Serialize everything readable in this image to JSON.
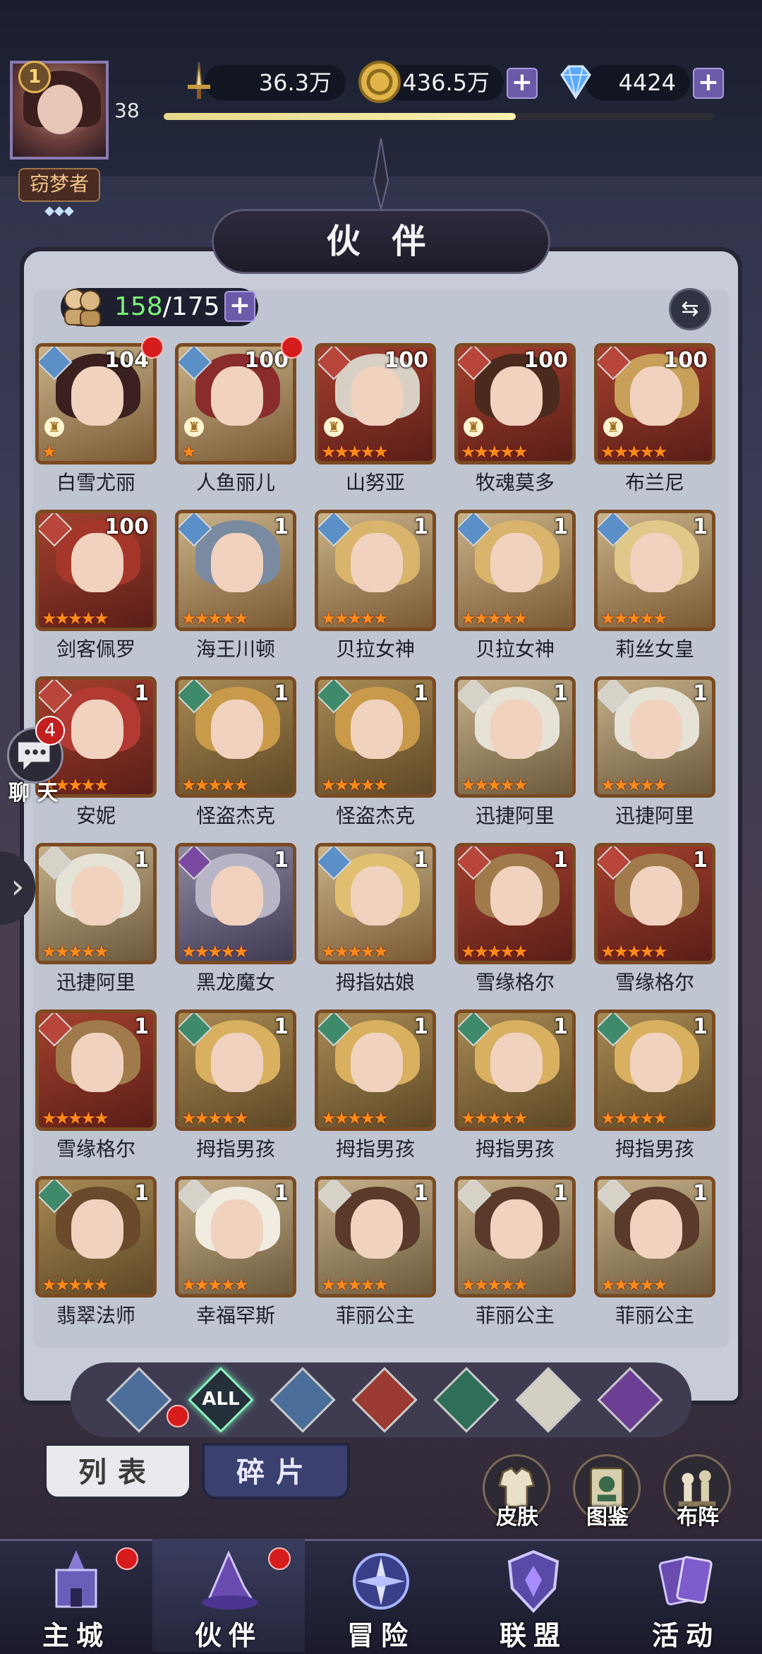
{
  "player": {
    "vip_level": "1",
    "level": "38",
    "title": "窃梦者",
    "title_diamonds": "◆◆◆",
    "xp_fraction": 0.64
  },
  "resources": {
    "power": "36.3万",
    "gold": "436.5万",
    "gems": "4424",
    "plus": "+"
  },
  "panel": {
    "title": "伙 伴",
    "owned": "158",
    "capacity": "/175",
    "swap_icon": "⇆"
  },
  "colors": {
    "water": "#5b8fc7",
    "fire": "#b8463a",
    "wind": "#3e8a6a",
    "light": "#d6d2c7",
    "dark": "#7a4aa0",
    "star": "#ff8c1a",
    "frame": "#7a4a22"
  },
  "heroes": [
    {
      "name": "白雪尤丽",
      "level": "104",
      "element": "water",
      "stars": "★",
      "has_pawn": true,
      "red_dot": true
    },
    {
      "name": "人鱼丽儿",
      "level": "100",
      "element": "water",
      "stars": "★",
      "has_pawn": true,
      "red_dot": true
    },
    {
      "name": "山努亚",
      "level": "100",
      "element": "fire",
      "stars": "★★★★★",
      "has_pawn": true,
      "red_dot": false
    },
    {
      "name": "牧魂莫多",
      "level": "100",
      "element": "fire",
      "stars": "★★★★★",
      "has_pawn": true,
      "red_dot": false
    },
    {
      "name": "布兰尼",
      "level": "100",
      "element": "fire",
      "stars": "★★★★★",
      "has_pawn": true,
      "red_dot": false
    },
    {
      "name": "剑客佩罗",
      "level": "100",
      "element": "fire",
      "stars": "★★★★★",
      "has_pawn": false,
      "red_dot": false
    },
    {
      "name": "海王川顿",
      "level": "1",
      "element": "water",
      "stars": "★★★★★",
      "has_pawn": false,
      "red_dot": false
    },
    {
      "name": "贝拉女神",
      "level": "1",
      "element": "water",
      "stars": "★★★★★",
      "has_pawn": false,
      "red_dot": false
    },
    {
      "name": "贝拉女神",
      "level": "1",
      "element": "water",
      "stars": "★★★★★",
      "has_pawn": false,
      "red_dot": false
    },
    {
      "name": "莉丝女皇",
      "level": "1",
      "element": "water",
      "stars": "★★★★★",
      "has_pawn": false,
      "red_dot": false
    },
    {
      "name": "安妮",
      "level": "1",
      "element": "fire",
      "stars": "★★★★★",
      "has_pawn": false,
      "red_dot": false
    },
    {
      "name": "怪盗杰克",
      "level": "1",
      "element": "wind",
      "stars": "★★★★★",
      "has_pawn": false,
      "red_dot": false
    },
    {
      "name": "怪盗杰克",
      "level": "1",
      "element": "wind",
      "stars": "★★★★★",
      "has_pawn": false,
      "red_dot": false
    },
    {
      "name": "迅捷阿里",
      "level": "1",
      "element": "light",
      "stars": "★★★★★",
      "has_pawn": false,
      "red_dot": false
    },
    {
      "name": "迅捷阿里",
      "level": "1",
      "element": "light",
      "stars": "★★★★★",
      "has_pawn": false,
      "red_dot": false
    },
    {
      "name": "迅捷阿里",
      "level": "1",
      "element": "light",
      "stars": "★★★★★",
      "has_pawn": false,
      "red_dot": false
    },
    {
      "name": "黑龙魔女",
      "level": "1",
      "element": "dark",
      "stars": "★★★★★",
      "has_pawn": false,
      "red_dot": false
    },
    {
      "name": "拇指姑娘",
      "level": "1",
      "element": "water",
      "stars": "★★★★★",
      "has_pawn": false,
      "red_dot": false
    },
    {
      "name": "雪缘格尔",
      "level": "1",
      "element": "fire",
      "stars": "★★★★★",
      "has_pawn": false,
      "red_dot": false
    },
    {
      "name": "雪缘格尔",
      "level": "1",
      "element": "fire",
      "stars": "★★★★★",
      "has_pawn": false,
      "red_dot": false
    },
    {
      "name": "雪缘格尔",
      "level": "1",
      "element": "fire",
      "stars": "★★★★★",
      "has_pawn": false,
      "red_dot": false
    },
    {
      "name": "拇指男孩",
      "level": "1",
      "element": "wind",
      "stars": "★★★★★",
      "has_pawn": false,
      "red_dot": false
    },
    {
      "name": "拇指男孩",
      "level": "1",
      "element": "wind",
      "stars": "★★★★★",
      "has_pawn": false,
      "red_dot": false
    },
    {
      "name": "拇指男孩",
      "level": "1",
      "element": "wind",
      "stars": "★★★★★",
      "has_pawn": false,
      "red_dot": false
    },
    {
      "name": "拇指男孩",
      "level": "1",
      "element": "wind",
      "stars": "★★★★★",
      "has_pawn": false,
      "red_dot": false
    },
    {
      "name": "翡翠法师",
      "level": "1",
      "element": "wind",
      "stars": "★★★★★",
      "has_pawn": false,
      "red_dot": false
    },
    {
      "name": "幸福罕斯",
      "level": "1",
      "element": "light",
      "stars": "★★★★★",
      "has_pawn": false,
      "red_dot": false
    },
    {
      "name": "菲丽公主",
      "level": "1",
      "element": "light",
      "stars": "★★★★★",
      "has_pawn": false,
      "red_dot": false
    },
    {
      "name": "菲丽公主",
      "level": "1",
      "element": "light",
      "stars": "★★★★★",
      "has_pawn": false,
      "red_dot": false
    },
    {
      "name": "菲丽公主",
      "level": "1",
      "element": "light",
      "stars": "★★★★★",
      "has_pawn": false,
      "red_dot": false
    }
  ],
  "filters": {
    "all_label": "ALL",
    "items": [
      "water",
      "all",
      "water",
      "fire",
      "wind",
      "light",
      "dark"
    ]
  },
  "tabs": {
    "list": "列表",
    "shards": "碎片"
  },
  "actions": {
    "skin": "皮肤",
    "gallery": "图鉴",
    "formation": "布阵"
  },
  "chat": {
    "label": "聊 天",
    "count": "4"
  },
  "nav": {
    "main_city": "主城",
    "partners": "伙伴",
    "adventure": "冒险",
    "alliance": "联盟",
    "events": "活动"
  }
}
